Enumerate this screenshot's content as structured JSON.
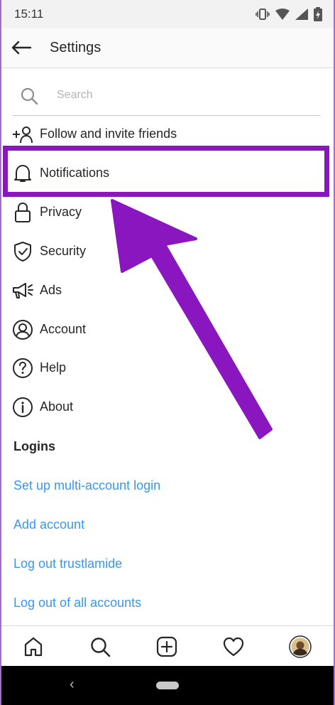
{
  "status": {
    "time": "15:11"
  },
  "header": {
    "title": "Settings"
  },
  "search": {
    "placeholder": "Search",
    "value": ""
  },
  "menu": [
    {
      "label": "Follow and invite friends",
      "icon": "add-person-icon"
    },
    {
      "label": "Notifications",
      "icon": "bell-icon"
    },
    {
      "label": "Privacy",
      "icon": "lock-icon"
    },
    {
      "label": "Security",
      "icon": "shield-icon"
    },
    {
      "label": "Ads",
      "icon": "megaphone-icon"
    },
    {
      "label": "Account",
      "icon": "user-circle-icon"
    },
    {
      "label": "Help",
      "icon": "help-circle-icon"
    },
    {
      "label": "About",
      "icon": "info-circle-icon"
    }
  ],
  "logins": {
    "title": "Logins",
    "links": [
      "Set up multi-account login",
      "Add account",
      "Log out trustlamide",
      "Log out of all accounts"
    ]
  },
  "tabs": [
    "home-icon",
    "search-icon",
    "add-post-icon",
    "heart-icon",
    "profile-avatar"
  ],
  "colors": {
    "link": "#3897f0",
    "highlight": "#8a16c0",
    "text": "#262626"
  }
}
